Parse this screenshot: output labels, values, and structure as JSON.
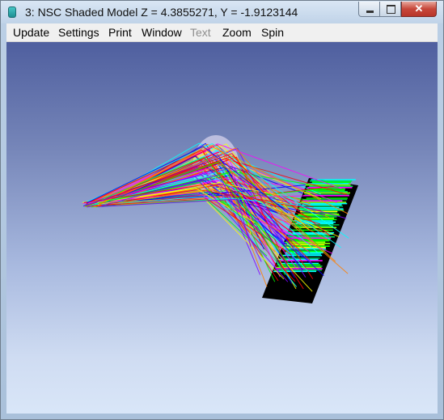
{
  "window": {
    "title": "3: NSC Shaded Model Z = 4.3855271, Y = -1.9123144",
    "app_icon": "zemax-app-icon",
    "controls": {
      "minimize": "minimize-icon",
      "maximize": "maximize-icon",
      "close": "close-icon"
    }
  },
  "menubar": {
    "items": [
      {
        "label": "Update",
        "enabled": true
      },
      {
        "label": "Settings",
        "enabled": true
      },
      {
        "label": "Print",
        "enabled": true
      },
      {
        "label": "Window",
        "enabled": true
      },
      {
        "label": "Text",
        "enabled": false
      },
      {
        "label": "Zoom",
        "enabled": true
      },
      {
        "label": "Spin",
        "enabled": true
      }
    ]
  },
  "viewport": {
    "background_top": "#4f5f9f",
    "background_bottom": "#d9e6f8",
    "lens_color": "#c4c4e2",
    "detector_color": "#000000",
    "ray_colors": [
      "#ff0000",
      "#ff00ff",
      "#00ff00",
      "#00ffff",
      "#0000ff",
      "#ffff00",
      "#ff8000",
      "#8000ff"
    ]
  }
}
